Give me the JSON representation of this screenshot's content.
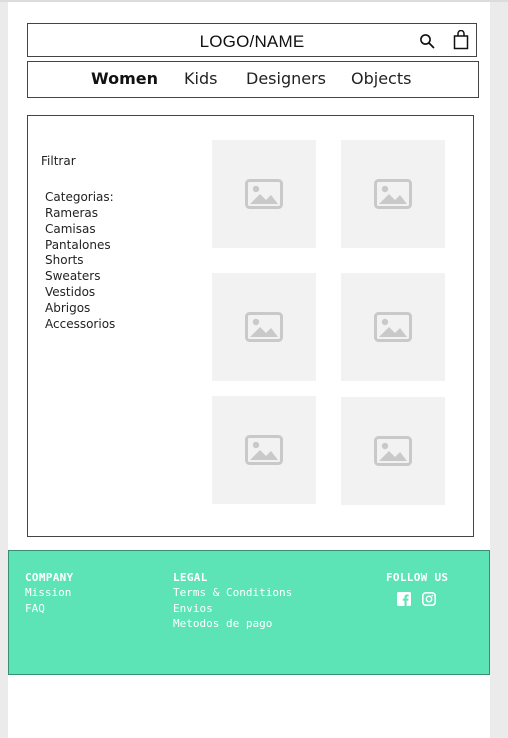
{
  "header": {
    "logo": "LOGO/NAME",
    "icons": [
      "search-icon",
      "shopping-bag-icon"
    ]
  },
  "nav": {
    "items": [
      {
        "label": "Women",
        "active": true
      },
      {
        "label": "Kids",
        "active": false
      },
      {
        "label": "Designers",
        "active": false
      },
      {
        "label": "Objects",
        "active": false
      }
    ]
  },
  "filter": {
    "title": "Filtrar",
    "categories_heading": "Categorias:",
    "categories": [
      "Rameras",
      "Camisas",
      "Pantalones",
      "Shorts",
      "Sweaters",
      "Vestidos",
      "Abrigos",
      "Accessorios"
    ]
  },
  "products": {
    "placeholder_icon": "image-placeholder-icon",
    "count": 6
  },
  "footer": {
    "company": {
      "heading": "COMPANY",
      "links": [
        "Mission",
        "FAQ"
      ]
    },
    "legal": {
      "heading": "LEGAL",
      "links": [
        "Terms & Conditions",
        "Envios",
        "Metodos de pago"
      ]
    },
    "follow": {
      "heading": "FOLLOW US",
      "icons": [
        "facebook-icon",
        "instagram-icon"
      ]
    },
    "background_color": "#5ce3b6"
  }
}
